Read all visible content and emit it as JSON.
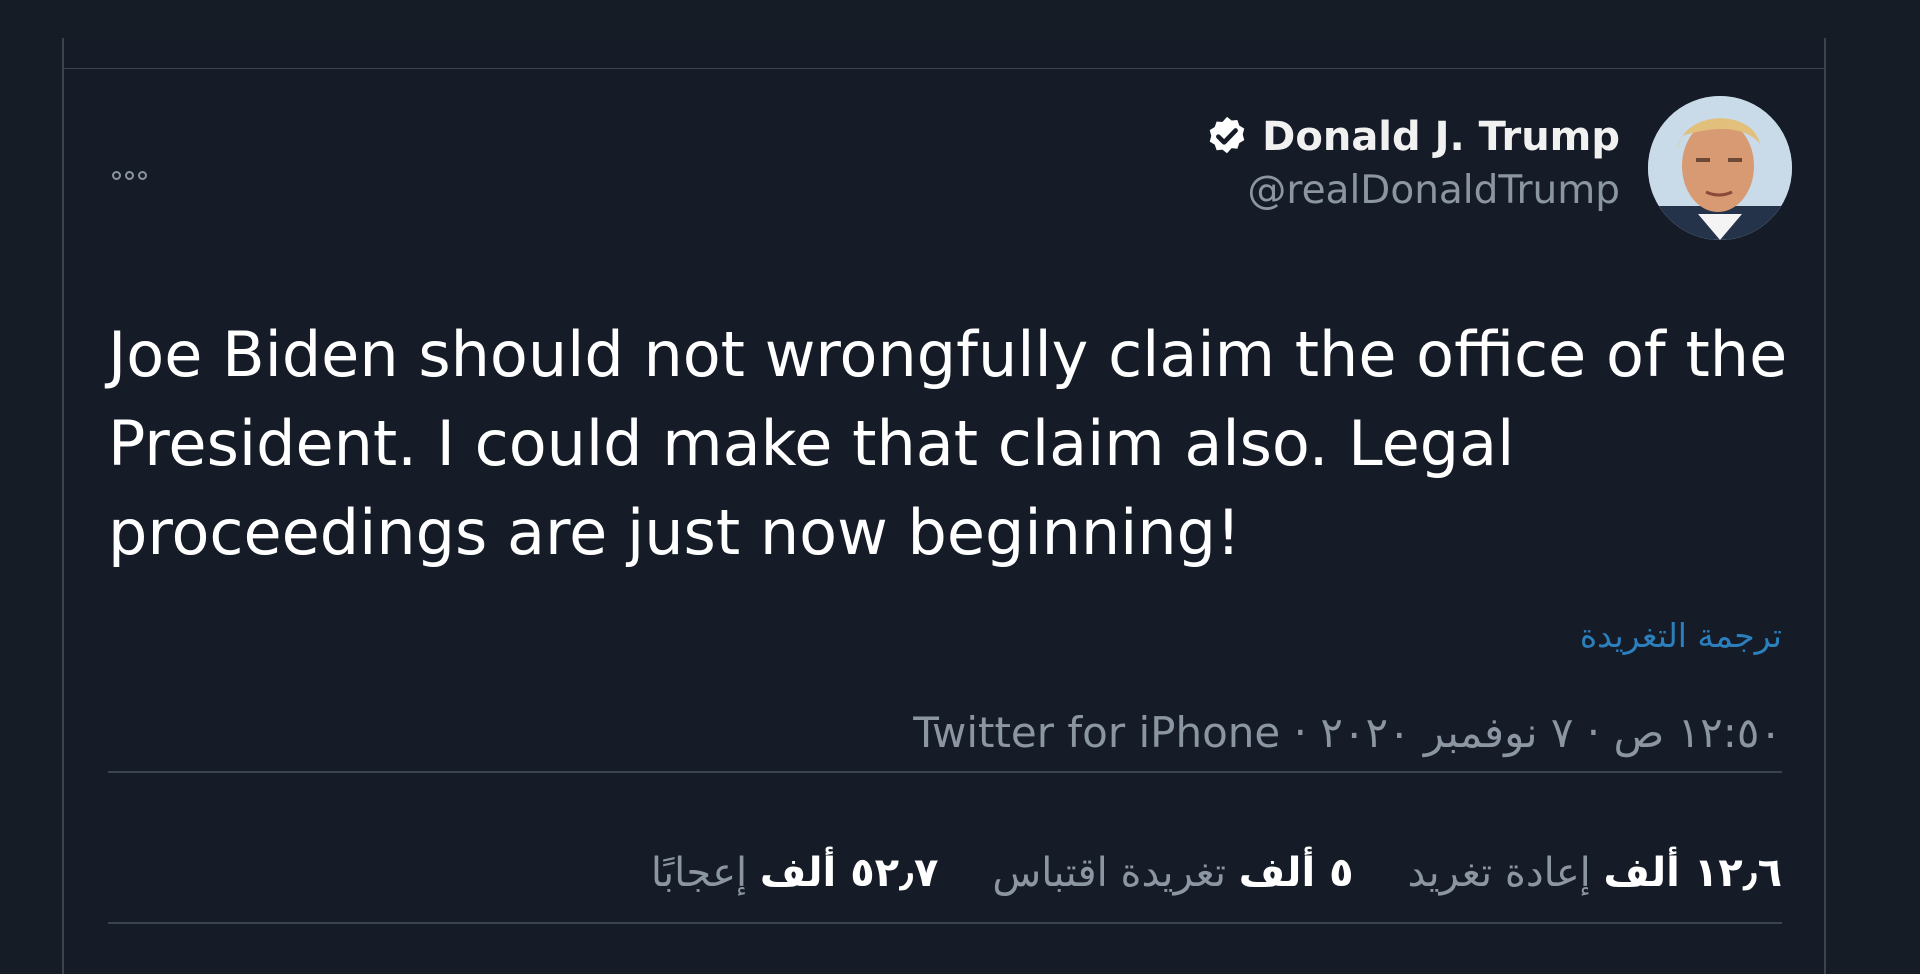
{
  "tweet": {
    "author": {
      "display_name": "Donald J. Trump",
      "handle": "@realDonaldTrump",
      "verified": true
    },
    "text": "Joe Biden should not wrongfully claim the office of the\nPresident. I could make that claim also. Legal\nproceedings are just now beginning!",
    "translate_label": "ترجمة التغريدة",
    "meta": "١٢:٥٠ ص · ٧ نوفمبر ٢٠٢٠ · Twitter for iPhone",
    "stats": {
      "retweets": {
        "count": "١٢٫٦ ألف",
        "label": "إعادة تغريد"
      },
      "quotes": {
        "count": "٥ ألف",
        "label": "تغريدة اقتباس"
      },
      "likes": {
        "count": "٥٢٫٧ ألف",
        "label": "إعجابًا"
      }
    }
  },
  "icons": {
    "more": "more-options-icon",
    "verified": "verified-badge-icon"
  },
  "colors": {
    "background": "#151c27",
    "link": "#2b7fbd",
    "secondary_text": "#8b96a2",
    "border": "#3a4350"
  }
}
